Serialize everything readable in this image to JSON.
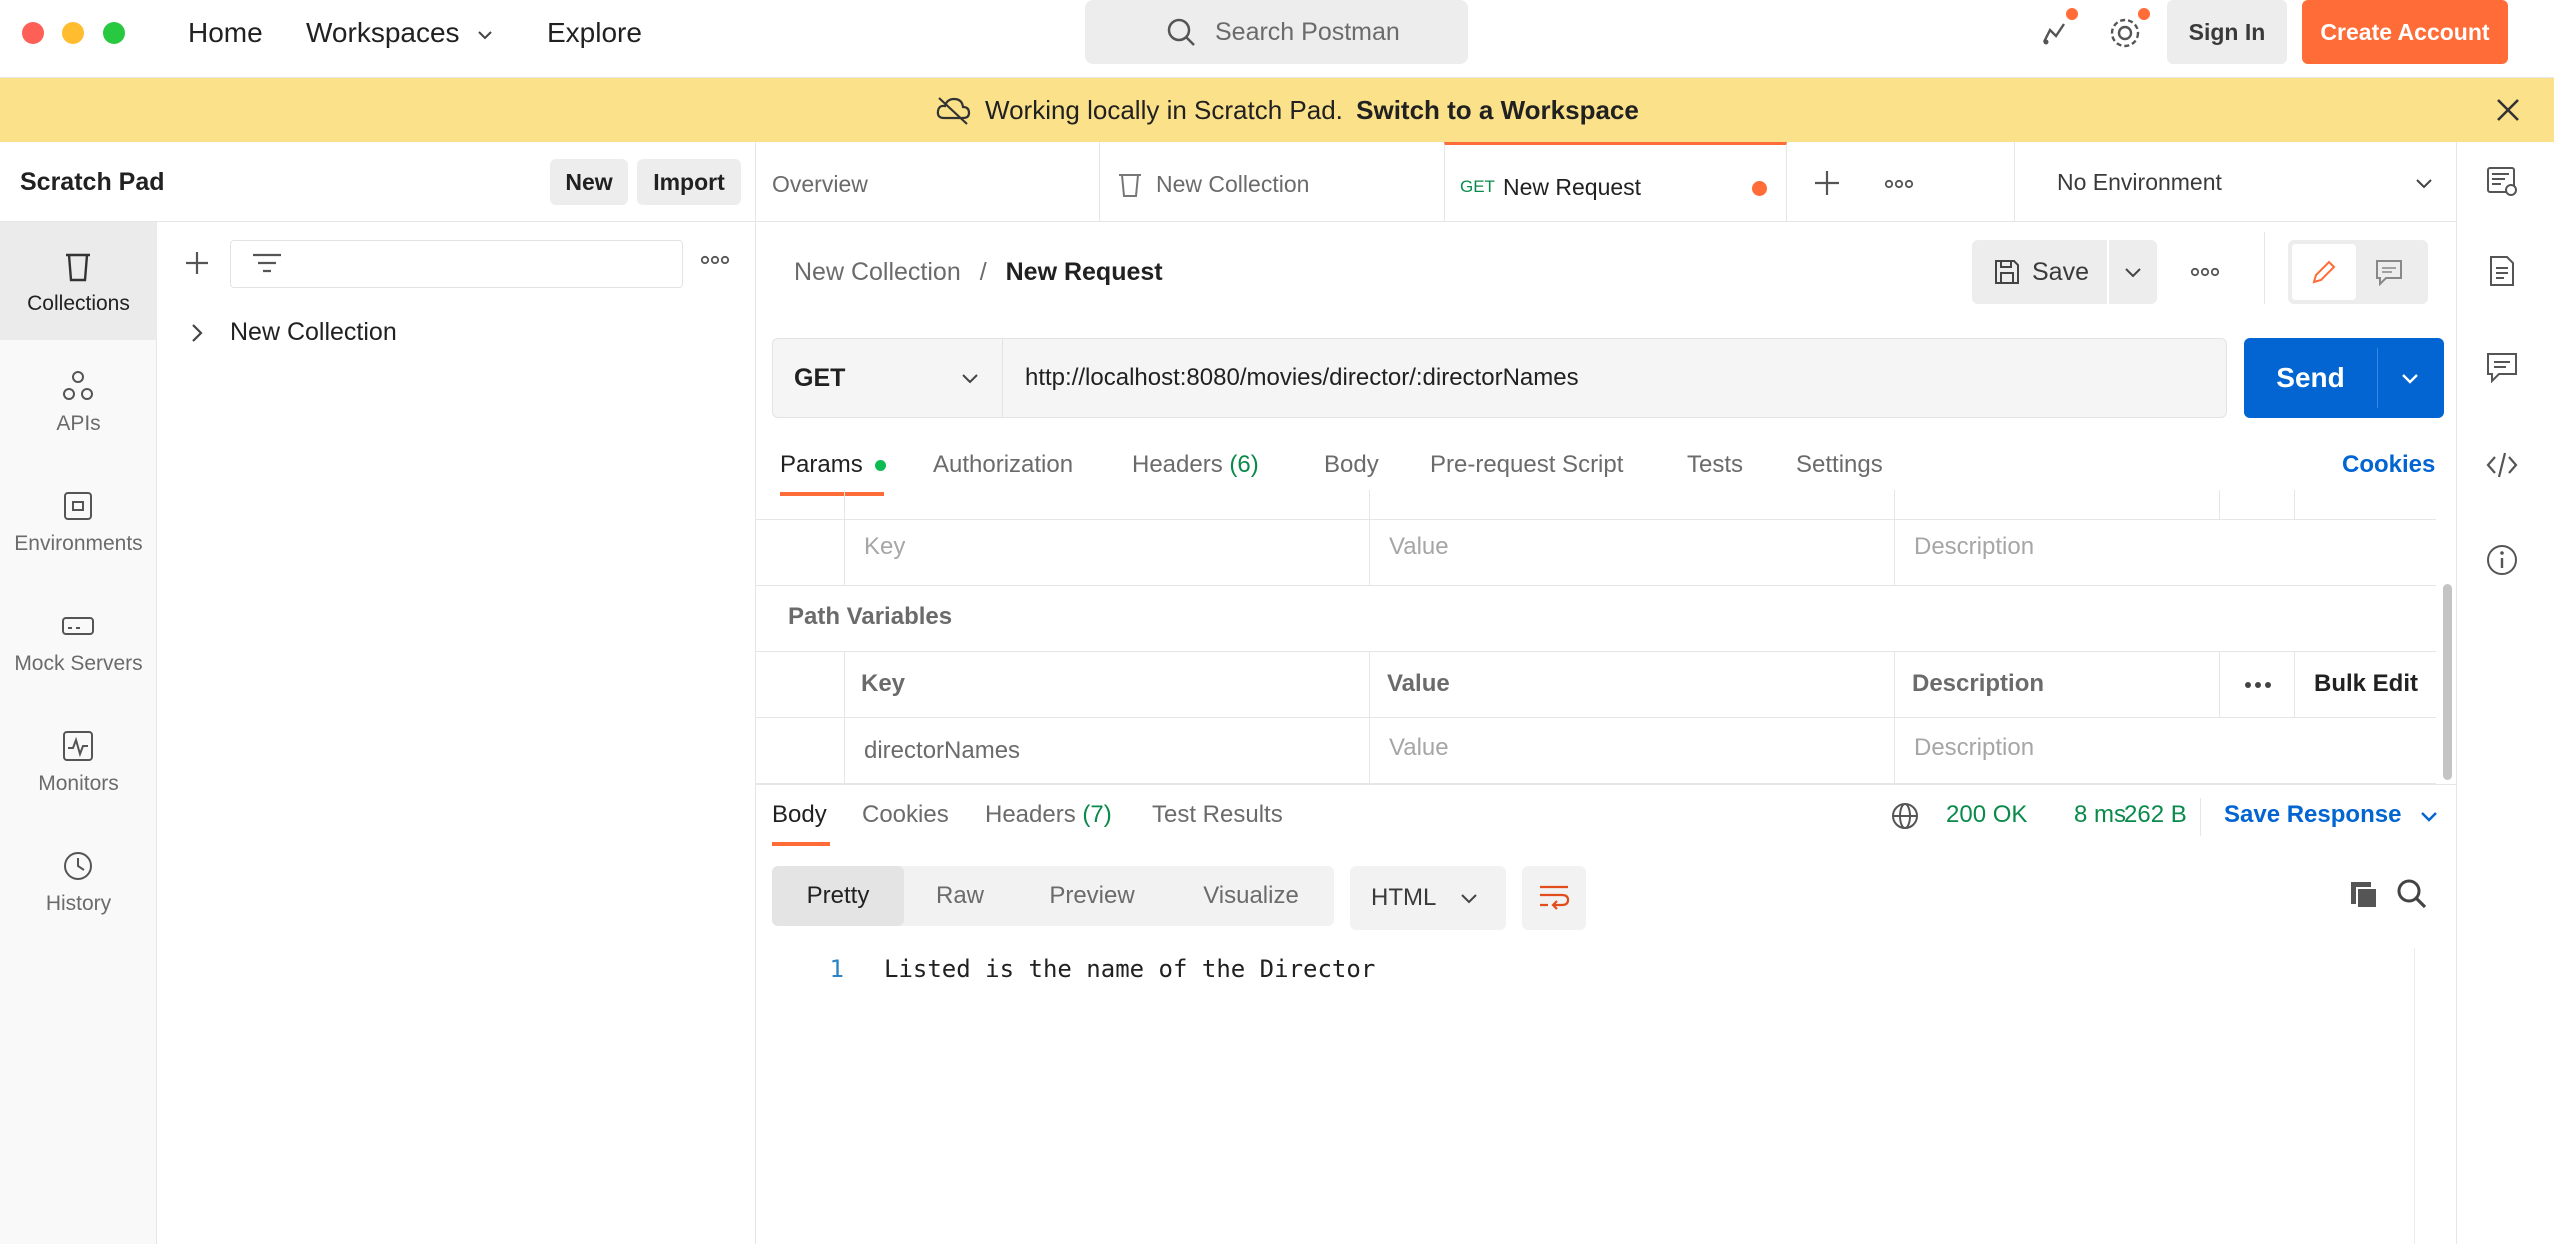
{
  "topbar": {
    "nav": [
      "Home",
      "Workspaces",
      "Explore"
    ],
    "search_placeholder": "Search Postman",
    "sign_in": "Sign In",
    "create_account": "Create Account"
  },
  "banner": {
    "text": "Working locally in Scratch Pad.",
    "link": "Switch to a Workspace"
  },
  "sidebar": {
    "title": "Scratch Pad",
    "new_label": "New",
    "import_label": "Import",
    "rail": [
      "Collections",
      "APIs",
      "Environments",
      "Mock Servers",
      "Monitors",
      "History"
    ],
    "tree": [
      {
        "label": "New Collection"
      }
    ]
  },
  "tabs": {
    "overview": "Overview",
    "collection": "New Collection",
    "request_method": "GET",
    "request_name": "New Request",
    "environment": "No Environment"
  },
  "request": {
    "breadcrumb_parent": "New Collection",
    "breadcrumb_sep": "/",
    "breadcrumb_current": "New Request",
    "save_label": "Save",
    "method": "GET",
    "url": "http://localhost:8080/movies/director/:directorNames",
    "send_label": "Send",
    "param_tabs": {
      "params": "Params",
      "authorization": "Authorization",
      "headers": "Headers",
      "headers_count": "(6)",
      "body": "Body",
      "prerequest": "Pre-request Script",
      "tests": "Tests",
      "settings": "Settings",
      "cookies": "Cookies"
    },
    "query_empty_row": {
      "key": "Key",
      "value": "Value",
      "description": "Description"
    },
    "path_variables_title": "Path Variables",
    "path_headers": {
      "key": "Key",
      "value": "Value",
      "description": "Description",
      "bulk_edit": "Bulk Edit"
    },
    "path_rows": [
      {
        "key": "directorNames",
        "value_placeholder": "Value",
        "description_placeholder": "Description"
      }
    ]
  },
  "response": {
    "tabs": {
      "body": "Body",
      "cookies": "Cookies",
      "headers": "Headers",
      "headers_count": "(7)",
      "test_results": "Test Results"
    },
    "status": "200 OK",
    "time": "8 ms",
    "size": "262 B",
    "save_response": "Save Response",
    "views": [
      "Pretty",
      "Raw",
      "Preview",
      "Visualize"
    ],
    "format": "HTML",
    "lines": [
      {
        "num": "1",
        "text": "Listed is the name of the Director"
      }
    ]
  },
  "colors": {
    "accent": "#ff6c37",
    "send_blue": "#0265d2",
    "banner": "#fbe28a",
    "success": "#0a8a4a"
  }
}
